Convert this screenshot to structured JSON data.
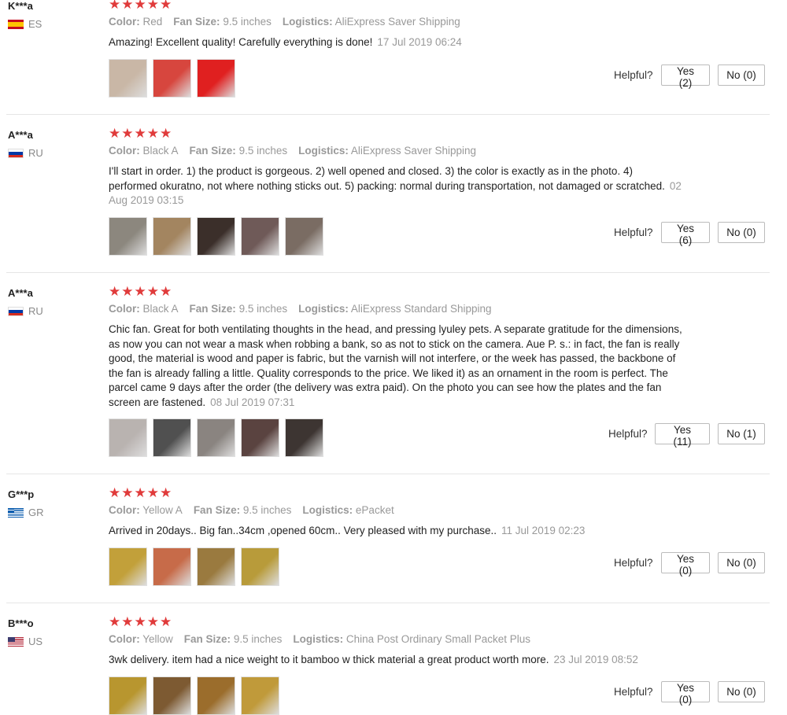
{
  "labels": {
    "color": "Color:",
    "fan_size": "Fan Size:",
    "logistics": "Logistics:",
    "helpful": "Helpful?"
  },
  "star_color": "#e03b3b",
  "reviews": [
    {
      "user": "K***a",
      "country": "ES",
      "stars": "★★★★★",
      "rating": 5,
      "color": "Red",
      "fan_size": "9.5 inches",
      "logistics": "AliExpress Saver Shipping",
      "text": "Amazing! Excellent quality! Carefully everything is done!",
      "date": "17 Jul 2019 06:24",
      "yes": "Yes (2)",
      "no": "No (0)",
      "thumb_colors": [
        "#c9b7a6",
        "#d7463e",
        "#e02020"
      ]
    },
    {
      "user": "A***a",
      "country": "RU",
      "stars": "★★★★★",
      "rating": 5,
      "color": "Black A",
      "fan_size": "9.5 inches",
      "logistics": "AliExpress Saver Shipping",
      "text": "I'll start in order. 1) the product is gorgeous. 2) well opened and closed. 3) the color is exactly as in the photo. 4) performed okuratno, not where nothing sticks out. 5) packing: normal during transportation, not damaged or scratched.",
      "date": "02 Aug 2019 03:15",
      "yes": "Yes (6)",
      "no": "No (0)",
      "thumb_colors": [
        "#8c877e",
        "#a38560",
        "#3b2f2a",
        "#6f5a58",
        "#7a6c63"
      ]
    },
    {
      "user": "A***a",
      "country": "RU",
      "stars": "★★★★★",
      "rating": 5,
      "color": "Black A",
      "fan_size": "9.5 inches",
      "logistics": "AliExpress Standard Shipping",
      "text": "Chic fan. Great for both ventilating thoughts in the head, and pressing lyuley pets. A separate gratitude for the dimensions, as now you can not wear a mask when robbing a bank, so as not to stick on the camera. Aue P. s.: in fact, the fan is really good, the material is wood and paper is fabric, but the varnish will not interfere, or the week has passed, the backbone of the fan is already falling a little. Quality corresponds to the price. We liked it) as an ornament in the room is perfect. The parcel came 9 days after the order (the delivery was extra paid). On the photo you can see how the plates and the fan screen are fastened.",
      "date": "08 Jul 2019 07:31",
      "yes": "Yes (11)",
      "no": "No (1)",
      "thumb_colors": [
        "#b9b3b0",
        "#505050",
        "#8a8480",
        "#5a4340",
        "#3d3532"
      ]
    },
    {
      "user": "G***p",
      "country": "GR",
      "stars": "★★★★★",
      "rating": 5,
      "color": "Yellow A",
      "fan_size": "9.5 inches",
      "logistics": "ePacket",
      "text": "Arrived in 20days.. Big fan..34cm ,opened 60cm.. Very pleased with my purchase..",
      "date": "11 Jul 2019 02:23",
      "yes": "Yes (0)",
      "no": "No (0)",
      "thumb_colors": [
        "#c2a03a",
        "#c76b49",
        "#9a7a3f",
        "#b89b3a"
      ]
    },
    {
      "user": "B***o",
      "country": "US",
      "stars": "★★★★★",
      "rating": 5,
      "color": "Yellow",
      "fan_size": "9.5 inches",
      "logistics": "China Post Ordinary Small Packet Plus",
      "text": "3wk delivery. item had a nice weight to it bamboo w thick material a great product worth more.",
      "date": "23 Jul 2019 08:52",
      "yes": "Yes (0)",
      "no": "No (0)",
      "thumb_colors": [
        "#b8962f",
        "#7d5a32",
        "#9b6d2c",
        "#c09a3a"
      ]
    }
  ]
}
